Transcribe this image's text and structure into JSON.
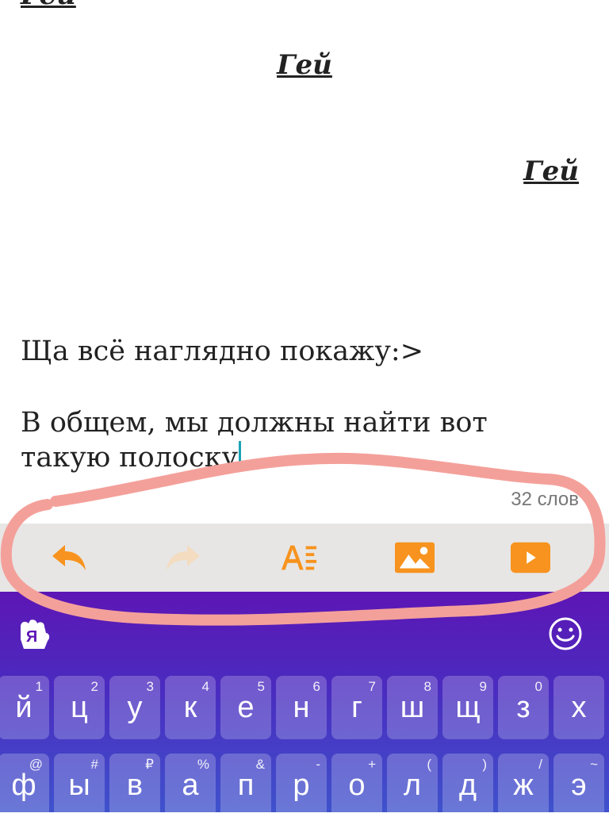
{
  "document": {
    "headings": [
      "Гей",
      "Гей",
      "Гей"
    ],
    "paragraphs": [
      "Ща всё наглядно покажу:>",
      "В общем, мы должны найти вот",
      "такую полоску"
    ],
    "word_count": "32 слов"
  },
  "toolbar": {
    "buttons": [
      "undo-icon",
      "redo-icon",
      "text-format-icon",
      "insert-image-icon",
      "insert-video-icon"
    ],
    "accent_color": "#f7931e",
    "disabled_color": "#f3dcc0"
  },
  "keyboard": {
    "row1": [
      {
        "key": "й",
        "hint": "1"
      },
      {
        "key": "ц",
        "hint": "2"
      },
      {
        "key": "у",
        "hint": "3"
      },
      {
        "key": "к",
        "hint": "4"
      },
      {
        "key": "е",
        "hint": "5"
      },
      {
        "key": "н",
        "hint": "6"
      },
      {
        "key": "г",
        "hint": "7"
      },
      {
        "key": "ш",
        "hint": "8"
      },
      {
        "key": "щ",
        "hint": "9"
      },
      {
        "key": "з",
        "hint": "0"
      },
      {
        "key": "х",
        "hint": ""
      }
    ],
    "row2": [
      {
        "key": "ф",
        "hint": "@"
      },
      {
        "key": "ы",
        "hint": "#"
      },
      {
        "key": "в",
        "hint": "₽"
      },
      {
        "key": "а",
        "hint": "%"
      },
      {
        "key": "п",
        "hint": "&"
      },
      {
        "key": "р",
        "hint": "-"
      },
      {
        "key": "о",
        "hint": "+"
      },
      {
        "key": "л",
        "hint": "("
      },
      {
        "key": "д",
        "hint": ")"
      },
      {
        "key": "ж",
        "hint": "/"
      },
      {
        "key": "э",
        "hint": "~"
      }
    ],
    "icons": [
      "yandex-logo-icon",
      "emoji-icon"
    ]
  },
  "annotation": {
    "color": "#f4a09a"
  }
}
